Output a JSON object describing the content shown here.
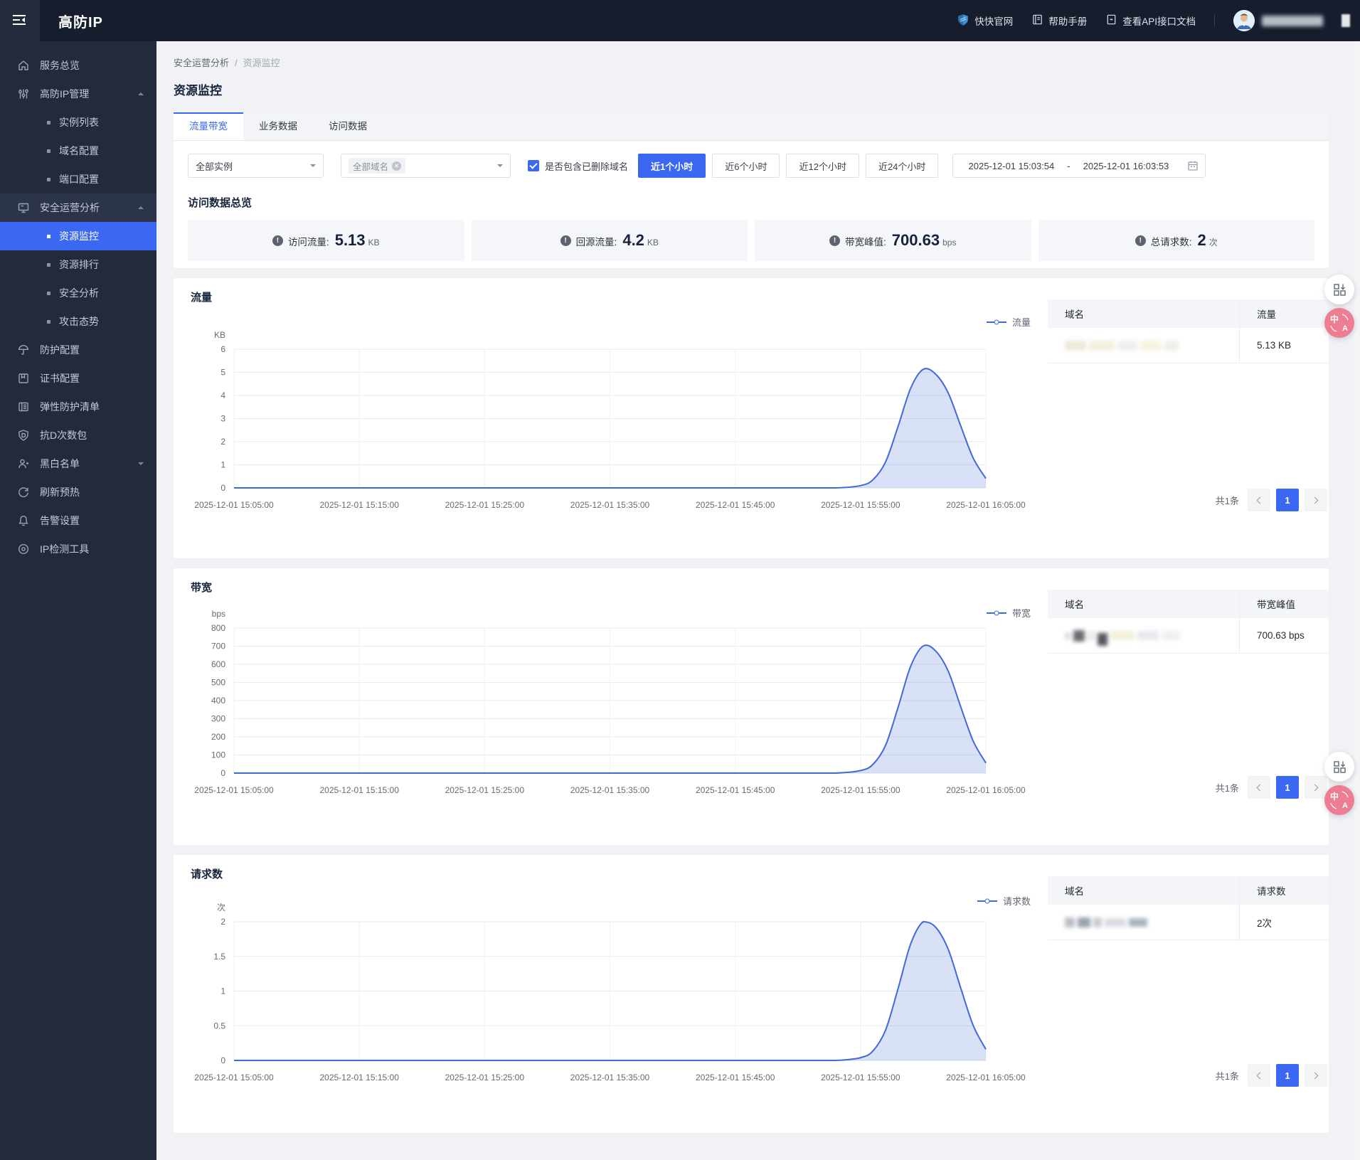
{
  "navbar": {
    "logo": "高防IP",
    "links": [
      {
        "label": "快快官网"
      },
      {
        "label": "帮助手册"
      },
      {
        "label": "查看API接口文档"
      }
    ]
  },
  "sidebar": {
    "items": [
      {
        "label": "服务总览"
      },
      {
        "label": "高防IP管理"
      },
      {
        "label": "实例列表"
      },
      {
        "label": "域名配置"
      },
      {
        "label": "端口配置"
      },
      {
        "label": "安全运营分析"
      },
      {
        "label": "资源监控",
        "active": true
      },
      {
        "label": "资源排行"
      },
      {
        "label": "安全分析"
      },
      {
        "label": "攻击态势"
      },
      {
        "label": "防护配置"
      },
      {
        "label": "证书配置"
      },
      {
        "label": "弹性防护清单"
      },
      {
        "label": "抗D次数包"
      },
      {
        "label": "黑白名单"
      },
      {
        "label": "刷新预热"
      },
      {
        "label": "告警设置"
      },
      {
        "label": "IP检测工具"
      }
    ]
  },
  "breadcrumb": {
    "parent": "安全运营分析",
    "separator": "/",
    "current": "资源监控"
  },
  "page": {
    "title": "资源监控"
  },
  "tabs": {
    "items": [
      {
        "label": "流量带宽",
        "active": true
      },
      {
        "label": "业务数据"
      },
      {
        "label": "访问数据"
      }
    ]
  },
  "filters": {
    "instance_select": "全部实例",
    "domain_tag": "全部域名",
    "checkbox_label": "是否包含已删除域名",
    "time_ranges": [
      {
        "label": "近1个小时",
        "active": true
      },
      {
        "label": "近6个小时"
      },
      {
        "label": "近12个小时"
      },
      {
        "label": "近24个小时"
      }
    ],
    "date_start": "2025-12-01 15:03:54",
    "date_separator": "-",
    "date_end": "2025-12-01 16:03:53"
  },
  "overview": {
    "title": "访问数据总览",
    "stats": [
      {
        "label": "访问流量:",
        "value": "5.13",
        "unit": "KB"
      },
      {
        "label": "回源流量:",
        "value": "4.2",
        "unit": "KB"
      },
      {
        "label": "带宽峰值:",
        "value": "700.63",
        "unit": "bps"
      },
      {
        "label": "总请求数:",
        "value": "2",
        "unit": "次"
      }
    ]
  },
  "chart_data": [
    {
      "type": "area",
      "title": "流量",
      "legend": "流量",
      "unit": "KB",
      "ylim": [
        0,
        6
      ],
      "yticks": [
        0,
        1,
        2,
        3,
        4,
        5,
        6
      ],
      "xlim": [
        0,
        60
      ],
      "x_labels": [
        "2025-12-01 15:05:00",
        "2025-12-01 15:15:00",
        "2025-12-01 15:25:00",
        "2025-12-01 15:35:00",
        "2025-12-01 15:45:00",
        "2025-12-01 15:55:00",
        "2025-12-01 16:05:00"
      ],
      "x": [
        0,
        5,
        10,
        15,
        20,
        25,
        30,
        35,
        40,
        45,
        48,
        50,
        51,
        52,
        53,
        54,
        55,
        56,
        57,
        58,
        59,
        60
      ],
      "values": [
        0,
        0,
        0,
        0,
        0,
        0,
        0,
        0,
        0,
        0,
        0,
        0.1,
        0.36,
        1.13,
        2.67,
        4.31,
        5.13,
        4.92,
        4.1,
        2.67,
        1.28,
        0.41
      ],
      "peak": 5.13,
      "grid": true,
      "legend_position": "top-right"
    },
    {
      "type": "area",
      "title": "带宽",
      "legend": "带宽",
      "unit": "bps",
      "ylim": [
        0,
        800
      ],
      "yticks": [
        0,
        100,
        200,
        300,
        400,
        500,
        600,
        700,
        800
      ],
      "xlim": [
        0,
        60
      ],
      "x_labels": [
        "2025-12-01 15:05:00",
        "2025-12-01 15:15:00",
        "2025-12-01 15:25:00",
        "2025-12-01 15:35:00",
        "2025-12-01 15:45:00",
        "2025-12-01 15:55:00",
        "2025-12-01 16:05:00"
      ],
      "x": [
        0,
        5,
        10,
        15,
        20,
        25,
        30,
        35,
        40,
        45,
        48,
        50,
        51,
        52,
        53,
        54,
        55,
        56,
        57,
        58,
        59,
        60
      ],
      "values": [
        0,
        0,
        0,
        0,
        0,
        0,
        0,
        0,
        0,
        0,
        0,
        14,
        49,
        154,
        364,
        589,
        700.63,
        673,
        561,
        364,
        175,
        56
      ],
      "peak": 700.63,
      "grid": true,
      "legend_position": "top-right"
    },
    {
      "type": "area",
      "title": "请求数",
      "legend": "请求数",
      "unit": "次",
      "ylim": [
        0,
        2
      ],
      "yticks": [
        0,
        0.5,
        1,
        1.5,
        2
      ],
      "xlim": [
        0,
        60
      ],
      "x_labels": [
        "2025-12-01 15:05:00",
        "2025-12-01 15:15:00",
        "2025-12-01 15:25:00",
        "2025-12-01 15:35:00",
        "2025-12-01 15:45:00",
        "2025-12-01 15:55:00",
        "2025-12-01 16:05:00"
      ],
      "x": [
        0,
        5,
        10,
        15,
        20,
        25,
        30,
        35,
        40,
        45,
        48,
        50,
        51,
        52,
        53,
        54,
        55,
        56,
        57,
        58,
        59,
        60
      ],
      "values": [
        0,
        0,
        0,
        0,
        0,
        0,
        0,
        0,
        0,
        0,
        0,
        0.04,
        0.14,
        0.44,
        1.04,
        1.68,
        2,
        1.92,
        1.6,
        1.04,
        0.5,
        0.16
      ],
      "peak": 2,
      "grid": true,
      "legend_position": "top-right"
    }
  ],
  "panels": [
    {
      "table": {
        "domain_header": "域名",
        "value_header": "流量",
        "value": "5.13 KB",
        "domain_redacted": true
      },
      "pagination": {
        "total": "共1条",
        "page": "1"
      }
    },
    {
      "table": {
        "domain_header": "域名",
        "value_header": "带宽峰值",
        "value": "700.63 bps",
        "domain_redacted": true
      },
      "pagination": {
        "total": "共1条",
        "page": "1"
      }
    },
    {
      "table": {
        "domain_header": "域名",
        "value_header": "请求数",
        "value": "2次",
        "domain_redacted": true
      },
      "pagination": {
        "total": "共1条",
        "page": "1"
      }
    }
  ],
  "icons": {
    "translate_zh": "中",
    "translate_en": "A"
  },
  "colors": {
    "accent_blue": "#3a68f2",
    "chart_line": "#4169d6",
    "chart_fill": "rgba(65,104,217,0.20)",
    "navbar_bg": "#161d2d",
    "sidebar_bg": "#222a3c",
    "widget_pink": "#ed7d92"
  }
}
